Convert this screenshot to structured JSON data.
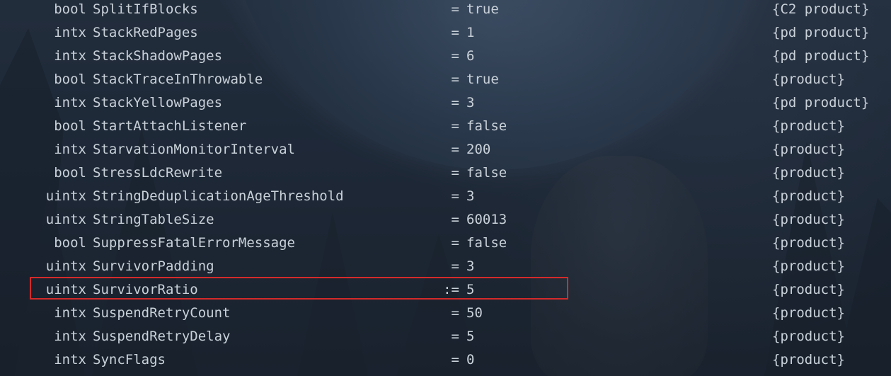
{
  "flags": [
    {
      "type": "bool",
      "name": "SplitIfBlocks",
      "assign": "=",
      "value": "true",
      "origin": "{C2 product}"
    },
    {
      "type": "intx",
      "name": "StackRedPages",
      "assign": "=",
      "value": "1",
      "origin": "{pd product}"
    },
    {
      "type": "intx",
      "name": "StackShadowPages",
      "assign": "=",
      "value": "6",
      "origin": "{pd product}"
    },
    {
      "type": "bool",
      "name": "StackTraceInThrowable",
      "assign": "=",
      "value": "true",
      "origin": "{product}"
    },
    {
      "type": "intx",
      "name": "StackYellowPages",
      "assign": "=",
      "value": "3",
      "origin": "{pd product}"
    },
    {
      "type": "bool",
      "name": "StartAttachListener",
      "assign": "=",
      "value": "false",
      "origin": "{product}"
    },
    {
      "type": "intx",
      "name": "StarvationMonitorInterval",
      "assign": "=",
      "value": "200",
      "origin": "{product}"
    },
    {
      "type": "bool",
      "name": "StressLdcRewrite",
      "assign": "=",
      "value": "false",
      "origin": "{product}"
    },
    {
      "type": "uintx",
      "name": "StringDeduplicationAgeThreshold",
      "assign": "=",
      "value": "3",
      "origin": "{product}"
    },
    {
      "type": "uintx",
      "name": "StringTableSize",
      "assign": "=",
      "value": "60013",
      "origin": "{product}"
    },
    {
      "type": "bool",
      "name": "SuppressFatalErrorMessage",
      "assign": "=",
      "value": "false",
      "origin": "{product}"
    },
    {
      "type": "uintx",
      "name": "SurvivorPadding",
      "assign": "=",
      "value": "3",
      "origin": "{product}"
    },
    {
      "type": "uintx",
      "name": "SurvivorRatio",
      "assign": ":=",
      "value": "5",
      "origin": "{product}"
    },
    {
      "type": "intx",
      "name": "SuspendRetryCount",
      "assign": "=",
      "value": "50",
      "origin": "{product}"
    },
    {
      "type": "intx",
      "name": "SuspendRetryDelay",
      "assign": "=",
      "value": "5",
      "origin": "{product}"
    },
    {
      "type": "intx",
      "name": "SyncFlags",
      "assign": "=",
      "value": "0",
      "origin": "{product}"
    }
  ],
  "highlighted_flag": "SurvivorRatio",
  "colors": {
    "text": "#c9d1d9",
    "highlight_border": "#d42a2a"
  }
}
